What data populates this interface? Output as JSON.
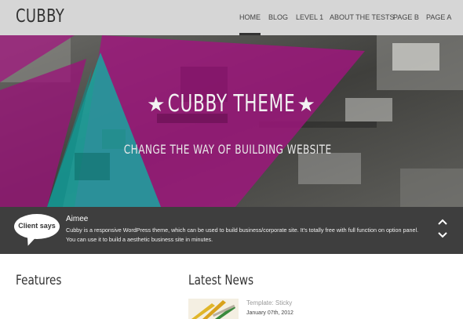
{
  "header": {
    "logo": "CUBBY",
    "nav": [
      {
        "label": "HOME",
        "active": true
      },
      {
        "label": "BLOG",
        "active": false
      },
      {
        "label": "LEVEL 1",
        "active": false
      },
      {
        "label": "ABOUT THE TESTS",
        "active": false
      },
      {
        "label": "PAGE B",
        "active": false
      },
      {
        "label": "PAGE A",
        "active": false
      }
    ]
  },
  "hero": {
    "title": "CUBBY THEME",
    "star": "★",
    "subtitle": "CHANGE THE WAY OF BUILDING WEBSITE",
    "colors": {
      "magenta": "#a0157e",
      "teal": "#1aa5a0",
      "dark": "#4a4a48"
    }
  },
  "testimonial": {
    "bubble_label": "Client says",
    "name": "Aimee",
    "text": "Cubby is a responsive WordPress theme, which can be used to build business/corporate site. It's totally free with full function on option panel. You can use it to build a aesthetic business site in minutes.",
    "prev_icon": "chevron-up-icon",
    "next_icon": "chevron-down-icon"
  },
  "features": {
    "title": "Features"
  },
  "latest_news": {
    "title": "Latest News",
    "items": [
      {
        "title": "Template: Sticky",
        "date": "January 07th, 2012"
      }
    ]
  }
}
